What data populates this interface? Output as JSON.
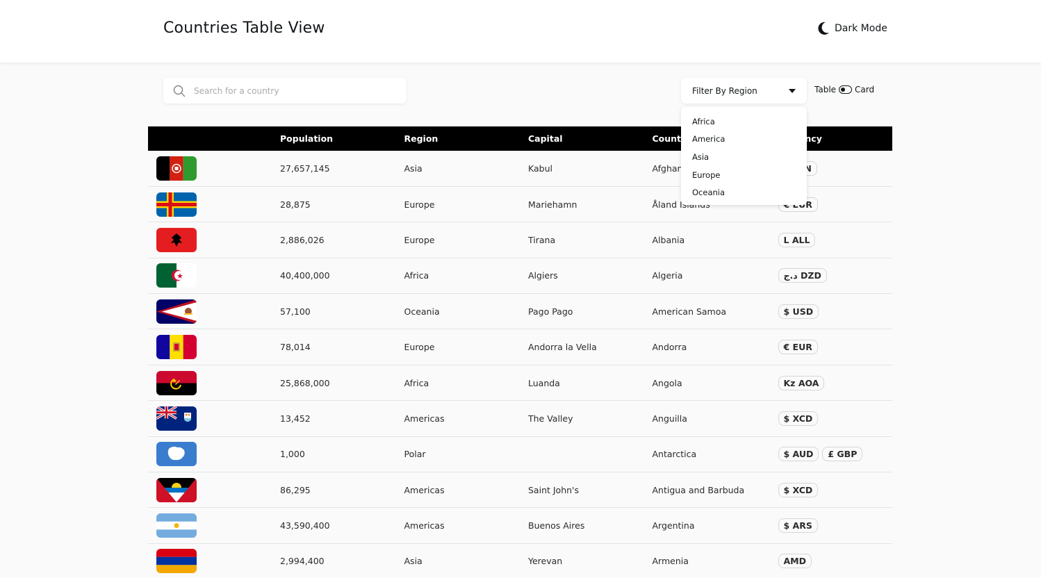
{
  "header": {
    "title": "Countries Table View",
    "dark_mode_label": "Dark Mode"
  },
  "search": {
    "placeholder": "Search for a country",
    "value": ""
  },
  "filter": {
    "label": "Filter By Region",
    "options": [
      "Africa",
      "America",
      "Asia",
      "Europe",
      "Oceania"
    ]
  },
  "view_toggle": {
    "left_label": "Table",
    "right_label": "Card"
  },
  "table": {
    "headers": [
      "",
      "Population",
      "Region",
      "Capital",
      "Country",
      "Currency"
    ],
    "rows": [
      {
        "flag": "afghanistan-flag",
        "population": "27,657,145",
        "region": "Asia",
        "capital": "Kabul",
        "country": "Afghanistan",
        "currencies": [
          "؋ AFN"
        ]
      },
      {
        "flag": "aland-flag",
        "population": "28,875",
        "region": "Europe",
        "capital": "Mariehamn",
        "country": "Åland Islands",
        "currencies": [
          "€ EUR"
        ]
      },
      {
        "flag": "albania-flag",
        "population": "2,886,026",
        "region": "Europe",
        "capital": "Tirana",
        "country": "Albania",
        "currencies": [
          "L ALL"
        ]
      },
      {
        "flag": "algeria-flag",
        "population": "40,400,000",
        "region": "Africa",
        "capital": "Algiers",
        "country": "Algeria",
        "currencies": [
          "د.ج DZD"
        ]
      },
      {
        "flag": "american-samoa-flag",
        "population": "57,100",
        "region": "Oceania",
        "capital": "Pago Pago",
        "country": "American Samoa",
        "currencies": [
          "$ USD"
        ]
      },
      {
        "flag": "andorra-flag",
        "population": "78,014",
        "region": "Europe",
        "capital": "Andorra la Vella",
        "country": "Andorra",
        "currencies": [
          "€ EUR"
        ]
      },
      {
        "flag": "angola-flag",
        "population": "25,868,000",
        "region": "Africa",
        "capital": "Luanda",
        "country": "Angola",
        "currencies": [
          "Kz AOA"
        ]
      },
      {
        "flag": "anguilla-flag",
        "population": "13,452",
        "region": "Americas",
        "capital": "The Valley",
        "country": "Anguilla",
        "currencies": [
          "$ XCD"
        ]
      },
      {
        "flag": "antarctica-flag",
        "population": "1,000",
        "region": "Polar",
        "capital": "",
        "country": "Antarctica",
        "currencies": [
          "$ AUD",
          "£ GBP"
        ]
      },
      {
        "flag": "antigua-flag",
        "population": "86,295",
        "region": "Americas",
        "capital": "Saint John's",
        "country": "Antigua and Barbuda",
        "currencies": [
          "$ XCD"
        ]
      },
      {
        "flag": "argentina-flag",
        "population": "43,590,400",
        "region": "Americas",
        "capital": "Buenos Aires",
        "country": "Argentina",
        "currencies": [
          "$ ARS"
        ]
      },
      {
        "flag": "armenia-flag",
        "population": "2,994,400",
        "region": "Asia",
        "capital": "Yerevan",
        "country": "Armenia",
        "currencies": [
          "AMD"
        ]
      }
    ]
  }
}
